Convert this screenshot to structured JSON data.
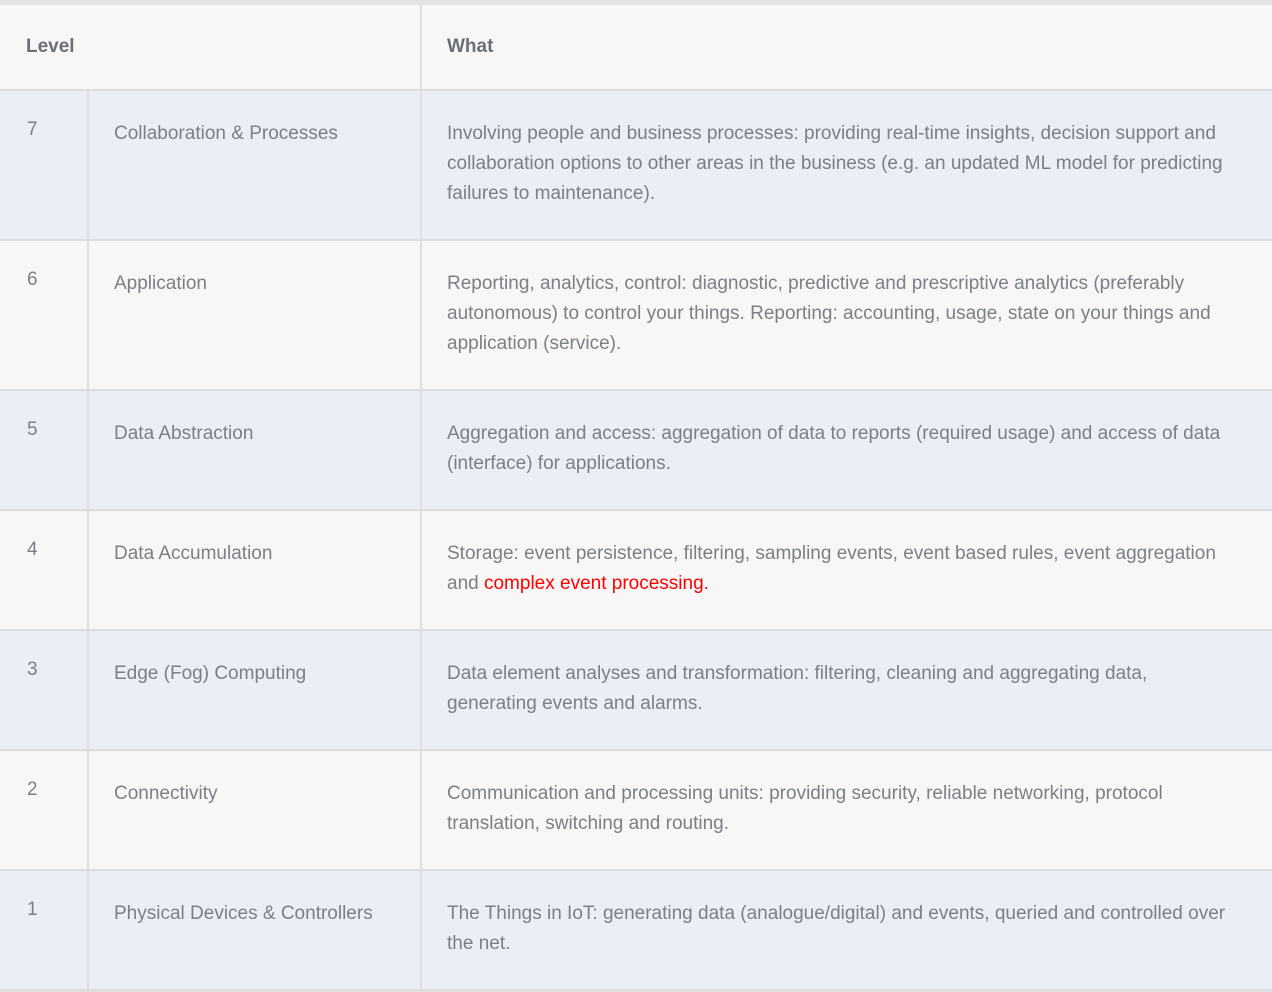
{
  "table": {
    "columns": [
      {
        "key": "level",
        "label": "Level"
      },
      {
        "key": "name",
        "label": ""
      },
      {
        "key": "what",
        "label": "What"
      }
    ],
    "highlight_color": "#ff0000",
    "rows": [
      {
        "level": "7",
        "name": "Collaboration & Processes",
        "what": "Involving people and business processes: providing real-time insights, decision support and collaboration options to other areas in the business (e.g. an updated ML model for predicting failures to maintenance).",
        "what_pre": "Involving people and business processes: providing real-time insights, decision support and collaboration options to other areas in the business (e.g. an updated ML model for predicting failures to maintenance).",
        "what_highlight": "",
        "what_post": ""
      },
      {
        "level": "6",
        "name": "Application",
        "what": "Reporting, analytics, control: diagnostic, predictive and prescriptive analytics (preferably autonomous) to control your things. Reporting: accounting, usage, state on your things and application (service).",
        "what_pre": "Reporting, analytics, control: diagnostic, predictive and prescriptive analytics (preferably autonomous) to control your things. Reporting: accounting, usage, state on your things and application (service).",
        "what_highlight": "",
        "what_post": ""
      },
      {
        "level": "5",
        "name": "Data Abstraction",
        "what": "Aggregation and access: aggregation of data to reports (required usage) and access of data (interface) for applications.",
        "what_pre": "Aggregation and access: aggregation of data to reports (required usage) and access of data (interface) for applications.",
        "what_highlight": "",
        "what_post": ""
      },
      {
        "level": "4",
        "name": "Data Accumulation",
        "what": "Storage: event persistence, filtering, sampling events, event based rules, event aggregation and complex event processing.",
        "what_pre": "Storage: event persistence, filtering, sampling events, event based rules, event aggregation and ",
        "what_highlight": "complex event processing.",
        "what_post": ""
      },
      {
        "level": "3",
        "name": "Edge (Fog) Computing",
        "what": "Data element analyses and transformation: filtering, cleaning and aggregating data, generating events and alarms.",
        "what_pre": "Data element analyses and transformation: filtering, cleaning and aggregating data, generating events and alarms.",
        "what_highlight": "",
        "what_post": ""
      },
      {
        "level": "2",
        "name": "Connectivity",
        "what": "Communication and processing units: providing security, reliable networking, protocol translation, switching and routing.",
        "what_pre": "Communication and processing units: providing security, reliable networking, protocol translation, switching and routing.",
        "what_highlight": "",
        "what_post": ""
      },
      {
        "level": "1",
        "name": "Physical Devices & Controllers",
        "what": "The Things in IoT: generating data (analogue/digital) and events, queried and controlled over the net.",
        "what_pre": "The Things in IoT: generating data (analogue/digital) and events, queried and controlled over the net.",
        "what_highlight": "",
        "what_post": ""
      }
    ]
  }
}
